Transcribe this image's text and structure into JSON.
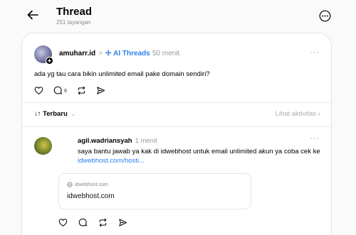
{
  "header": {
    "title": "Thread",
    "views": "251 tayangan"
  },
  "post": {
    "username": "amuharr.id",
    "separator": ">",
    "topic_icon": "✢",
    "topic": "AI Threads",
    "time": "50 menit",
    "more": "···",
    "text": "ada yg tau cara bikin unlimited email pake domain sendiri?",
    "reply_count": "6"
  },
  "sort": {
    "label": "↓↑ Terbaru",
    "chevron": "⌄",
    "activity": "Lihat aktivitas",
    "activity_chevron": "›"
  },
  "reply": {
    "username": "agil.wadriansyah",
    "time": "1 menit",
    "more": "···",
    "text": "saya bantu jawab ya kak di idwebhost untuk email unlimited akun ya coba cek ke ",
    "link": "idwebhost.com/hosti...",
    "preview_domain": "idwebhost.com",
    "preview_title": "idwebhost.com"
  },
  "colors": {
    "accent": "#2d7ff0",
    "muted": "#999999"
  }
}
